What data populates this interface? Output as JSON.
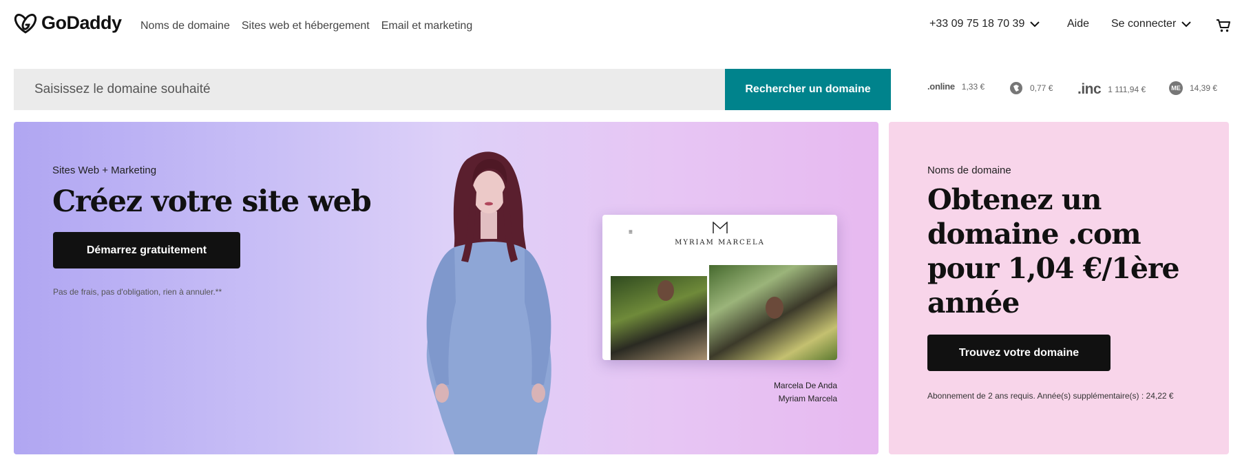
{
  "header": {
    "brand": "GoDaddy",
    "nav": [
      "Noms de domaine",
      "Sites web et hébergement",
      "Email et marketing"
    ],
    "phone": "+33 09 75 18 70 39",
    "help": "Aide",
    "signin": "Se connecter"
  },
  "search": {
    "placeholder": "Saisissez le domaine souhaité",
    "button": "Rechercher un domaine"
  },
  "tlds": [
    {
      "name": "online",
      "mark": ".online",
      "price": "1,33 €"
    },
    {
      "name": "club",
      "mark": "",
      "price": "0,77 €"
    },
    {
      "name": "inc",
      "mark": ".inc",
      "price": "1 111,94 €"
    },
    {
      "name": "me",
      "mark": "ME",
      "price": "14,39 €"
    }
  ],
  "hero": {
    "eyebrow": "Sites Web + Marketing",
    "title": "Créez votre site web",
    "button": "Démarrez gratuitement",
    "note": "Pas de frais, pas d'obligation, rien à annuler.**",
    "mock_brand": "MYRIAM MARCELA",
    "mock_menu": "≡",
    "credit_name": "Marcela De Anda",
    "credit_site": "Myriam Marcela"
  },
  "promo": {
    "eyebrow": "Noms de domaine",
    "title": "Obtenez un domaine .com pour 1,04 €/1ère année",
    "button": "Trouvez votre domaine",
    "note": "Abonnement de 2 ans requis. Année(s) supplémentaire(s) : 24,22 €"
  }
}
